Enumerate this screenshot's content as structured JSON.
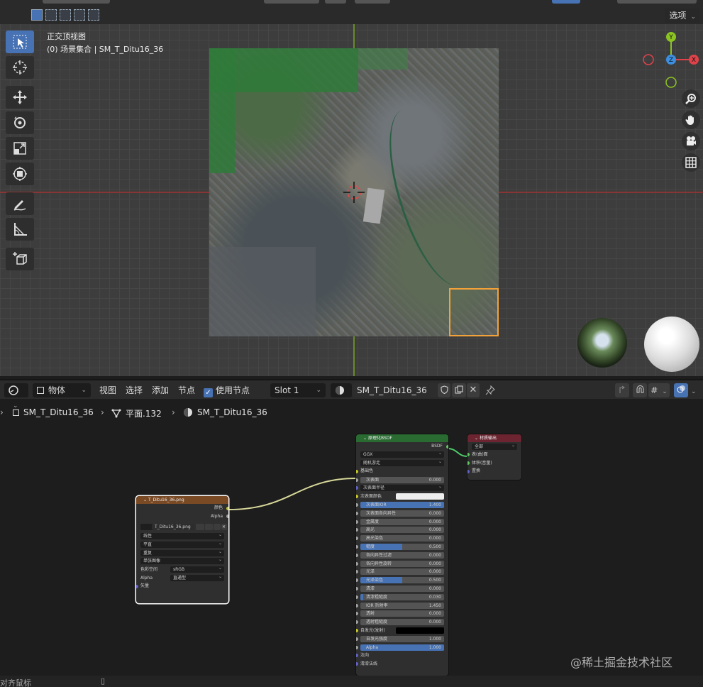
{
  "viewport": {
    "options_label": "选项",
    "view_name": "正交顶视图",
    "collection_info": "(0) 场景集合 | SM_T_Ditu16_36",
    "gizmo": {
      "y": "Y",
      "z": "Z",
      "x": "X"
    },
    "tools": [
      "select-box",
      "cursor",
      "move",
      "rotate",
      "scale",
      "transform",
      "annotate",
      "measure",
      "add-cube"
    ],
    "axis_colors": {
      "x": "#8a3535",
      "y": "#6b8a2a",
      "x_gizmo": "#e0424a",
      "y_gizmo": "#8bc323",
      "z_gizmo": "#3d8fe0"
    },
    "selection_color": "#f3a23a"
  },
  "node_header": {
    "editor_type_icon": "node-editor-icon",
    "object_mode": "物体",
    "menu": [
      "视图",
      "选择",
      "添加",
      "节点"
    ],
    "use_nodes_label": "使用节点",
    "slot": "Slot 1",
    "material_name": "SM_T_Ditu16_36"
  },
  "breadcrumb": {
    "object": "SM_T_Ditu16_36",
    "mesh": "平面.132",
    "material": "SM_T_Ditu16_36"
  },
  "image_node": {
    "title": "T_Ditu16_36.png",
    "out_color": "颜色",
    "out_alpha": "Alpha",
    "image_name": "T_Ditu16_36.png",
    "interp": "线性",
    "projection": "平直",
    "extension": "重复",
    "source": "单张图像",
    "colorspace_label": "色彩空间",
    "colorspace_value": "sRGB",
    "alpha_label": "Alpha",
    "alpha_value": "直通型",
    "in_vector": "矢量"
  },
  "bsdf_node": {
    "title": "原理化BSDF",
    "out": "BSDF",
    "distribution": "GGX",
    "subsurface_method": "随机游走",
    "base_color": "基础色",
    "rows": [
      {
        "label": "次表面",
        "value": "0.000",
        "fill": 0
      },
      {
        "label": "次表面半径",
        "value": "",
        "dropdown": true
      },
      {
        "label": "次表面颜色",
        "value": "",
        "color": "#eeeeee"
      },
      {
        "label": "次表面IOR",
        "value": "1.400",
        "fill": 1
      },
      {
        "label": "次表面各向异性",
        "value": "0.000",
        "fill": 0
      },
      {
        "label": "金属度",
        "value": "0.000",
        "fill": 0
      },
      {
        "label": "高光",
        "value": "0.000",
        "fill": 0
      },
      {
        "label": "高光染色",
        "value": "0.000",
        "fill": 0
      },
      {
        "label": "糙度",
        "value": "0.500",
        "fill": 0.5
      },
      {
        "label": "各向异性过滤",
        "value": "0.000",
        "fill": 0
      },
      {
        "label": "各向异性旋转",
        "value": "0.000",
        "fill": 0
      },
      {
        "label": "光泽",
        "value": "0.000",
        "fill": 0
      },
      {
        "label": "光泽染色",
        "value": "0.500",
        "fill": 0.5
      },
      {
        "label": "清漆",
        "value": "0.000",
        "fill": 0
      },
      {
        "label": "清漆粗糙度",
        "value": "0.030",
        "fill": 0.03
      },
      {
        "label": "IOR 折射率",
        "value": "1.450",
        "fill": 0
      },
      {
        "label": "透射",
        "value": "0.000",
        "fill": 0
      },
      {
        "label": "透射粗糙度",
        "value": "0.000",
        "fill": 0
      },
      {
        "label": "自发光(发射)",
        "value": "",
        "color": "#000000"
      },
      {
        "label": "自发光强度",
        "value": "1.000",
        "fill": 0
      },
      {
        "label": "Alpha",
        "value": "1.000",
        "fill": 1
      }
    ],
    "normal": "法向",
    "clearcoat_normal": "清漆法线"
  },
  "output_node": {
    "title": "材质输出",
    "target": "全部",
    "surface": "表(曲)面",
    "volume": "体积(音量)",
    "displacement": "置换"
  },
  "status": {
    "left_text": "对齐鼠标"
  },
  "watermark": "@稀土掘金技术社区"
}
